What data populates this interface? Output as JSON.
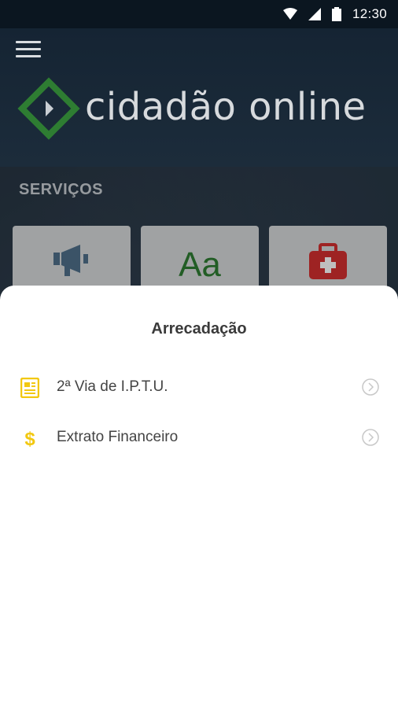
{
  "status_bar": {
    "time": "12:30"
  },
  "header": {
    "brand": "cidadão online"
  },
  "services": {
    "title": "SERVIÇOS",
    "tiles": [
      {
        "icon": "megaphone-icon",
        "color": "#4f6f8a"
      },
      {
        "icon": "text-format-icon",
        "text": "Aa",
        "color": "#2e7d32"
      },
      {
        "icon": "medical-kit-icon",
        "color": "#d32f2f"
      }
    ]
  },
  "sheet": {
    "title": "Arrecadação",
    "items": [
      {
        "label": "2ª Via de I.P.T.U.",
        "icon": "document-icon",
        "icon_color": "#f2c811"
      },
      {
        "label": "Extrato Financeiro",
        "icon": "dollar-icon",
        "icon_color": "#f2c811"
      }
    ]
  },
  "colors": {
    "logo_green": "#2e7d32",
    "accent_yellow": "#f2c811"
  }
}
